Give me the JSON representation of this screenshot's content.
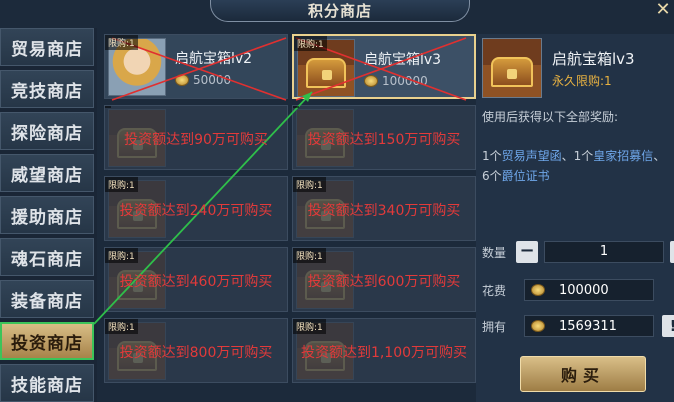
{
  "header": {
    "title": "积分商店",
    "close_icon": "close-icon"
  },
  "sidebar": {
    "items": [
      {
        "label": "贸易商店",
        "active": false
      },
      {
        "label": "竞技商店",
        "active": false
      },
      {
        "label": "探险商店",
        "active": false
      },
      {
        "label": "威望商店",
        "active": false
      },
      {
        "label": "援助商店",
        "active": false
      },
      {
        "label": "魂石商店",
        "active": false
      },
      {
        "label": "装备商店",
        "active": false
      },
      {
        "label": "投资商店",
        "active": true
      },
      {
        "label": "技能商店",
        "active": false
      }
    ]
  },
  "grid": {
    "cards": [
      {
        "limit": "限购:1",
        "name": "启航宝箱lv2",
        "price": "50000",
        "state": "unlocked",
        "thumb": "portrait",
        "lock_text": ""
      },
      {
        "limit": "限购:1",
        "name": "启航宝箱lv3",
        "price": "100000",
        "state": "selected",
        "thumb": "chest",
        "lock_text": ""
      },
      {
        "limit": "",
        "name": "",
        "price": "",
        "state": "locked",
        "thumb": "chest",
        "lock_text": "投资额达到90万可购买"
      },
      {
        "limit": "",
        "name": "",
        "price": "",
        "state": "locked",
        "thumb": "chest",
        "lock_text": "投资额达到150万可购买"
      },
      {
        "limit": "限购:1",
        "name": "",
        "price": "",
        "state": "locked",
        "thumb": "chest",
        "lock_text": "投资额达到240万可购买"
      },
      {
        "limit": "限购:1",
        "name": "",
        "price": "",
        "state": "locked",
        "thumb": "chest",
        "lock_text": "投资额达到340万可购买"
      },
      {
        "limit": "限购:1",
        "name": "",
        "price": "",
        "state": "locked",
        "thumb": "chest",
        "lock_text": "投资额达到460万可购买"
      },
      {
        "limit": "限购:1",
        "name": "",
        "price": "",
        "state": "locked",
        "thumb": "chest",
        "lock_text": "投资额达到600万可购买"
      },
      {
        "limit": "限购:1",
        "name": "",
        "price": "",
        "state": "locked",
        "thumb": "chest",
        "lock_text": "投资额达到800万可购买"
      },
      {
        "limit": "限购:1",
        "name": "",
        "price": "",
        "state": "locked",
        "thumb": "chest",
        "lock_text": "投资额达到1,100万可购买"
      }
    ]
  },
  "detail": {
    "name": "启航宝箱lv3",
    "limit": "永久限购:1",
    "desc_title": "使用后获得以下全部奖励:",
    "rewards": {
      "p1": "1个",
      "item1": "贸易声望函",
      "p2": "、1个",
      "item2": "皇家招募信",
      "p3": "、",
      "p4": "6个",
      "item3": "爵位证书"
    },
    "qty_label": "数量",
    "qty_value": "1",
    "minus_label": "−",
    "plus_label": "+",
    "cost_label": "花费",
    "cost_value": "100000",
    "owned_label": "拥有",
    "owned_value": "1569311",
    "info_label": "!",
    "buy_label": "购买"
  },
  "colors": {
    "accent_gold": "#d9bf88",
    "lock_red": "#e23a3a",
    "highlight_blue": "#6fa7ea",
    "annotation_green": "#2fbf4a",
    "annotation_red": "#e03030"
  }
}
